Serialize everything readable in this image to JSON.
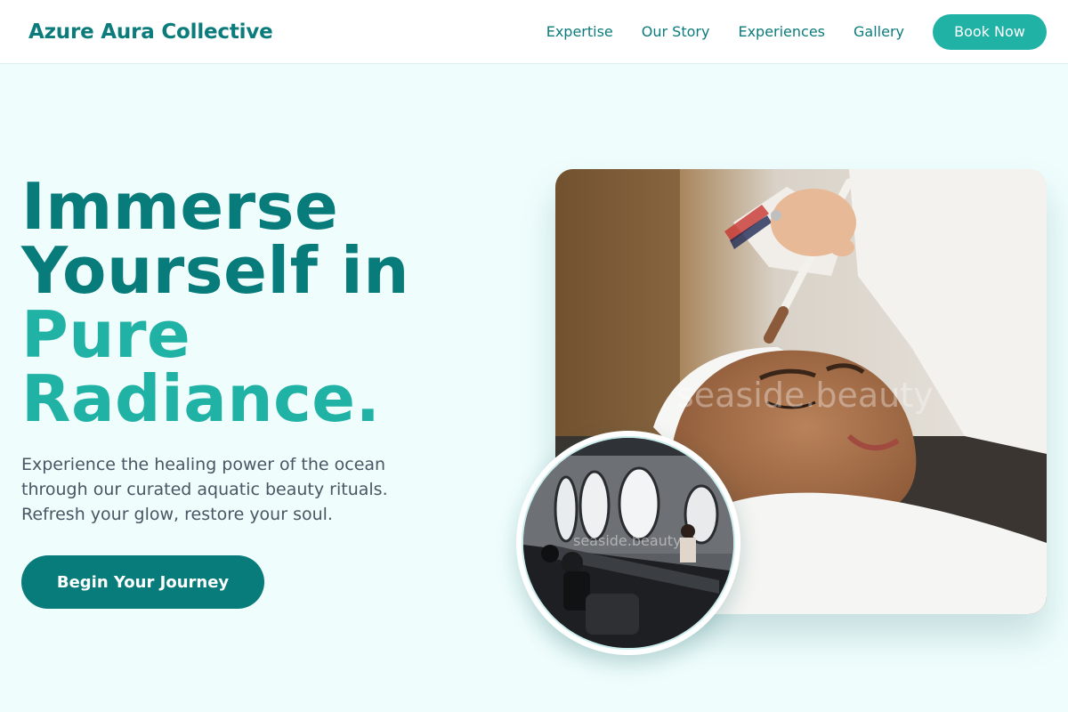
{
  "header": {
    "brand": "Azure Aura Collective",
    "nav": [
      "Expertise",
      "Our Story",
      "Experiences",
      "Gallery"
    ],
    "cta_label": "Book Now"
  },
  "hero": {
    "title_line1": "Immerse",
    "title_line2": "Yourself in",
    "title_line3": "Pure",
    "title_line4": "Radiance.",
    "subtitle": "Experience the healing power of the ocean through our curated aquatic beauty rituals. Refresh your glow, restore your soul.",
    "cta_label": "Begin Your Journey"
  },
  "images": {
    "main_watermark": "seaside.beauty",
    "circle_watermark": "seaside.beauty"
  },
  "colors": {
    "primary": "#087b7b",
    "accent": "#21b2a6",
    "background": "#effdfd"
  }
}
